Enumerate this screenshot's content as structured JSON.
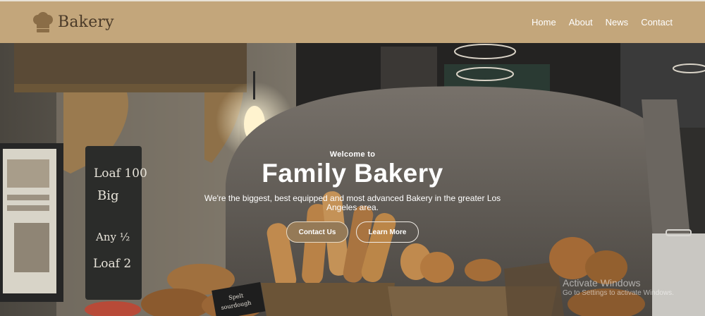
{
  "header": {
    "brand": "Bakery",
    "nav": [
      {
        "label": "Home"
      },
      {
        "label": "About"
      },
      {
        "label": "News"
      },
      {
        "label": "Contact"
      }
    ]
  },
  "hero": {
    "welcome": "Welcome to",
    "title": "Family Bakery",
    "description": "We're the biggest, best equipped and most advanced Bakery in the greater Los Angeles area.",
    "buttons": {
      "contact": "Contact Us",
      "learn": "Learn More"
    },
    "chalkboard": [
      "Loaf 100",
      "Big",
      "Any ½",
      "Loaf 2"
    ],
    "price_tag": [
      "Spelt",
      "sourdough"
    ]
  },
  "overlay": {
    "watermark_title": "Activate Windows",
    "watermark_sub": "Go to Settings to activate Windows."
  },
  "colors": {
    "header_bg": "#c3a67b",
    "primary_button": "#957a57",
    "brand_text": "#4a3a28"
  }
}
